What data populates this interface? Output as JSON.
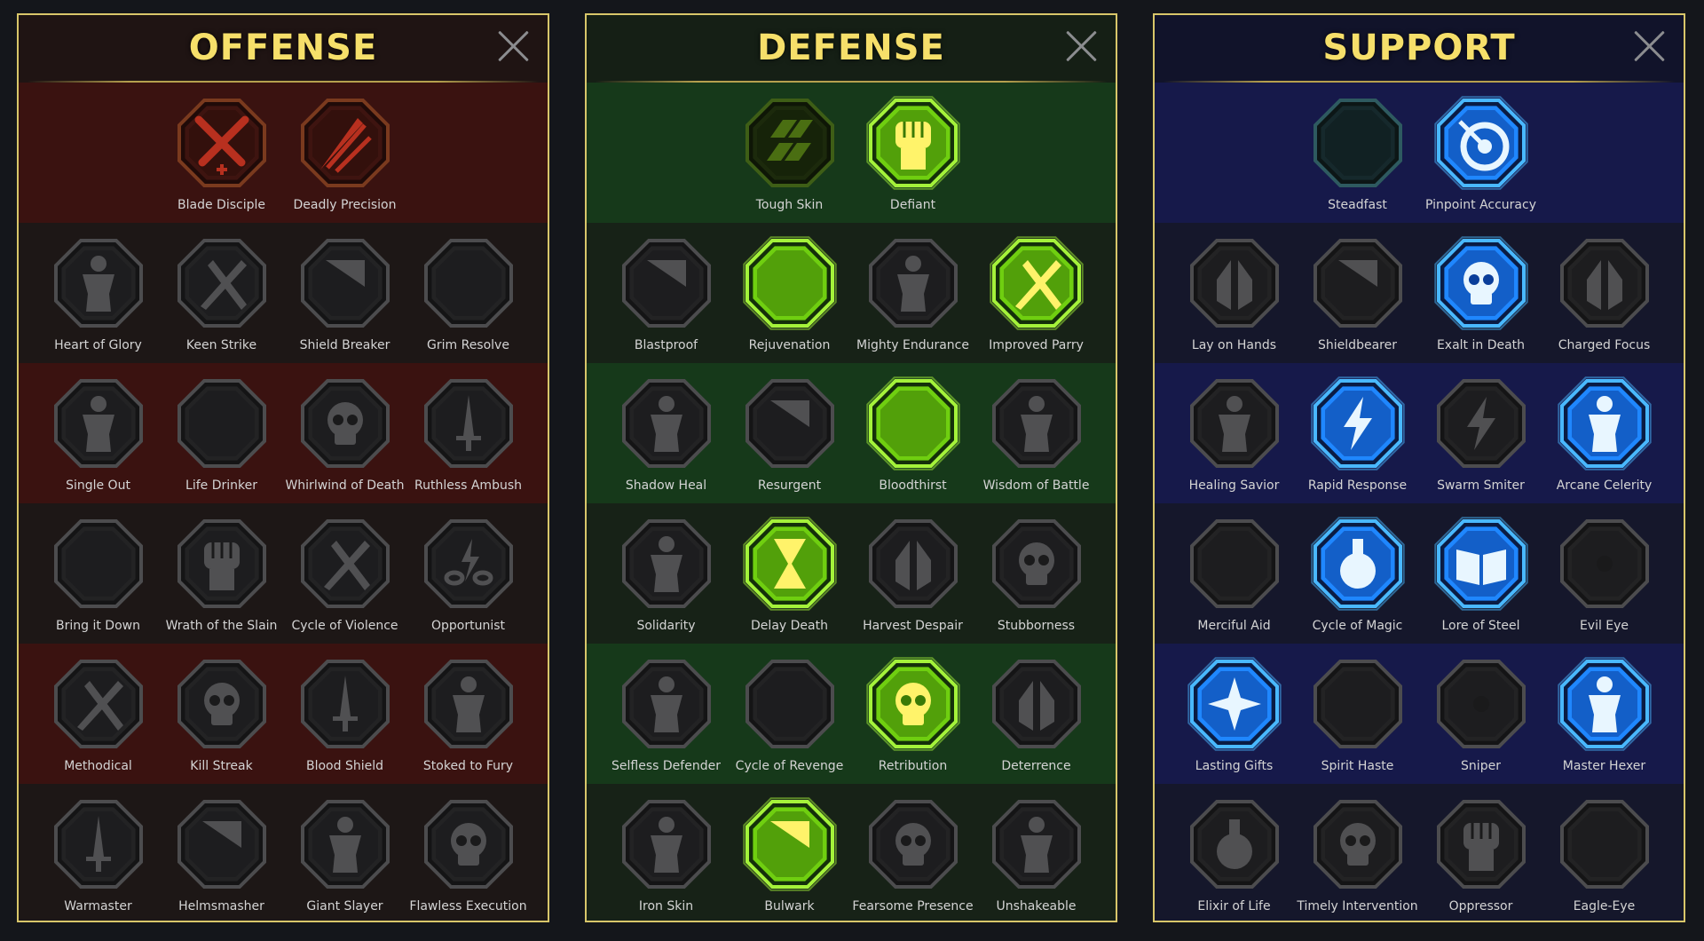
{
  "colors": {
    "title": "#f6df6a",
    "active_offense_rim": "#8b3a26",
    "active_defense_rim": "#a4f23a",
    "active_support_rim": "#49b8ff",
    "inactive_rim": "#4c4c4e"
  },
  "panels": [
    {
      "id": "offense",
      "title": "OFFENSE",
      "close_icon": "close-icon",
      "rows": [
        [
          {
            "name": "Blade Disciple",
            "icon": "crossed-swords-icon",
            "state": "tinted"
          },
          {
            "name": "Deadly Precision",
            "icon": "dagger-slash-icon",
            "state": "tinted"
          }
        ],
        [
          {
            "name": "Heart of Glory",
            "icon": "horned-figure-icon",
            "state": "locked"
          },
          {
            "name": "Keen Strike",
            "icon": "slash-icon",
            "state": "locked"
          },
          {
            "name": "Shield Breaker",
            "icon": "broken-shield-icon",
            "state": "locked"
          },
          {
            "name": "Grim Resolve",
            "icon": "dripping-heart-icon",
            "state": "locked"
          }
        ],
        [
          {
            "name": "Single Out",
            "icon": "arrows-figure-icon",
            "state": "locked"
          },
          {
            "name": "Life Drinker",
            "icon": "fangs-icon",
            "state": "locked"
          },
          {
            "name": "Whirlwind of Death",
            "icon": "skull-whirl-icon",
            "state": "locked"
          },
          {
            "name": "Ruthless Ambush",
            "icon": "hand-blade-icon",
            "state": "locked"
          }
        ],
        [
          {
            "name": "Bring it Down",
            "icon": "sword-heart-icon",
            "state": "locked"
          },
          {
            "name": "Wrath of the Slain",
            "icon": "fist-blade-icon",
            "state": "locked"
          },
          {
            "name": "Cycle of Violence",
            "icon": "axe-icon",
            "state": "locked"
          },
          {
            "name": "Opportunist",
            "icon": "chains-bolt-icon",
            "state": "locked"
          }
        ],
        [
          {
            "name": "Methodical",
            "icon": "blades-fan-icon",
            "state": "locked"
          },
          {
            "name": "Kill Streak",
            "icon": "skulls-icon",
            "state": "locked"
          },
          {
            "name": "Blood Shield",
            "icon": "sword-shield-icon",
            "state": "locked"
          },
          {
            "name": "Stoked to Fury",
            "icon": "raging-figure-icon",
            "state": "locked"
          }
        ],
        [
          {
            "name": "Warmaster",
            "icon": "sparkle-sword-icon",
            "state": "locked"
          },
          {
            "name": "Helmsmasher",
            "icon": "helmet-icon",
            "state": "locked"
          },
          {
            "name": "Giant Slayer",
            "icon": "giant-icon",
            "state": "locked"
          },
          {
            "name": "Flawless Execution",
            "icon": "skull-sun-icon",
            "state": "locked"
          }
        ]
      ]
    },
    {
      "id": "defense",
      "title": "DEFENSE",
      "close_icon": "close-icon",
      "rows": [
        [
          {
            "name": "Tough Skin",
            "icon": "scales-icon",
            "state": "dim"
          },
          {
            "name": "Defiant",
            "icon": "raised-fist-icon",
            "state": "active"
          }
        ],
        [
          {
            "name": "Blastproof",
            "icon": "shield-plate-icon",
            "state": "locked"
          },
          {
            "name": "Rejuvenation",
            "icon": "anatomical-heart-icon",
            "state": "active"
          },
          {
            "name": "Mighty Endurance",
            "icon": "armored-figure-icon",
            "state": "locked"
          },
          {
            "name": "Improved Parry",
            "icon": "crossed-blades-icon",
            "state": "active"
          }
        ],
        [
          {
            "name": "Shadow Heal",
            "icon": "shadow-figures-icon",
            "state": "locked"
          },
          {
            "name": "Resurgent",
            "icon": "knight-shield-icon",
            "state": "locked"
          },
          {
            "name": "Bloodthirst",
            "icon": "skull-heart-icon",
            "state": "active"
          },
          {
            "name": "Wisdom of Battle",
            "icon": "hooded-head-icon",
            "state": "locked"
          }
        ],
        [
          {
            "name": "Solidarity",
            "icon": "crowd-icon",
            "state": "locked"
          },
          {
            "name": "Delay Death",
            "icon": "hourglass-icon",
            "state": "active"
          },
          {
            "name": "Harvest Despair",
            "icon": "open-hand-icon",
            "state": "locked"
          },
          {
            "name": "Stubborness",
            "icon": "bull-icon",
            "state": "locked"
          }
        ],
        [
          {
            "name": "Selfless Defender",
            "icon": "running-shield-icon",
            "state": "locked"
          },
          {
            "name": "Cycle of Revenge",
            "icon": "drops-icon",
            "state": "locked"
          },
          {
            "name": "Retribution",
            "icon": "skull-burst-icon",
            "state": "active"
          },
          {
            "name": "Deterrence",
            "icon": "hand-swirl-icon",
            "state": "locked"
          }
        ],
        [
          {
            "name": "Iron Skin",
            "icon": "spiked-figure-icon",
            "state": "locked"
          },
          {
            "name": "Bulwark",
            "icon": "winged-shield-icon",
            "state": "active"
          },
          {
            "name": "Fearsome Presence",
            "icon": "dark-skull-icon",
            "state": "locked"
          },
          {
            "name": "Unshakeable",
            "icon": "strongman-icon",
            "state": "locked"
          }
        ]
      ]
    },
    {
      "id": "support",
      "title": "SUPPORT",
      "close_icon": "close-icon",
      "rows": [
        [
          {
            "name": "Steadfast",
            "icon": "heart-plus-icon",
            "state": "dim"
          },
          {
            "name": "Pinpoint Accuracy",
            "icon": "target-icon",
            "state": "active"
          }
        ],
        [
          {
            "name": "Lay on Hands",
            "icon": "praying-hands-icon",
            "state": "locked"
          },
          {
            "name": "Shieldbearer",
            "icon": "shield-ring-icon",
            "state": "locked"
          },
          {
            "name": "Exalt in Death",
            "icon": "flaming-skull-icon",
            "state": "active"
          },
          {
            "name": "Charged Focus",
            "icon": "swift-hand-icon",
            "state": "locked"
          }
        ],
        [
          {
            "name": "Healing Savior",
            "icon": "healing-figure-icon",
            "state": "locked"
          },
          {
            "name": "Rapid Response",
            "icon": "lightning-icon",
            "state": "active"
          },
          {
            "name": "Swarm Smiter",
            "icon": "crack-bolt-icon",
            "state": "locked"
          },
          {
            "name": "Arcane Celerity",
            "icon": "speed-figure-icon",
            "state": "active"
          }
        ],
        [
          {
            "name": "Merciful Aid",
            "icon": "chained-heart-icon",
            "state": "locked"
          },
          {
            "name": "Cycle of Magic",
            "icon": "comet-icon",
            "state": "active"
          },
          {
            "name": "Lore of Steel",
            "icon": "open-book-icon",
            "state": "active"
          },
          {
            "name": "Evil Eye",
            "icon": "claw-eye-icon",
            "state": "locked"
          }
        ],
        [
          {
            "name": "Lasting Gifts",
            "icon": "compass-star-icon",
            "state": "active"
          },
          {
            "name": "Spirit Haste",
            "icon": "winged-boot-icon",
            "state": "locked"
          },
          {
            "name": "Sniper",
            "icon": "eye-icon",
            "state": "locked"
          },
          {
            "name": "Master Hexer",
            "icon": "voodoo-doll-icon",
            "state": "active"
          }
        ],
        [
          {
            "name": "Elixir of Life",
            "icon": "potion-icon",
            "state": "locked"
          },
          {
            "name": "Timely Intervention",
            "icon": "winged-skull-icon",
            "state": "locked"
          },
          {
            "name": "Oppressor",
            "icon": "crushing-fist-icon",
            "state": "locked"
          },
          {
            "name": "Eagle-Eye",
            "icon": "eagle-icon",
            "state": "locked"
          }
        ]
      ]
    }
  ]
}
